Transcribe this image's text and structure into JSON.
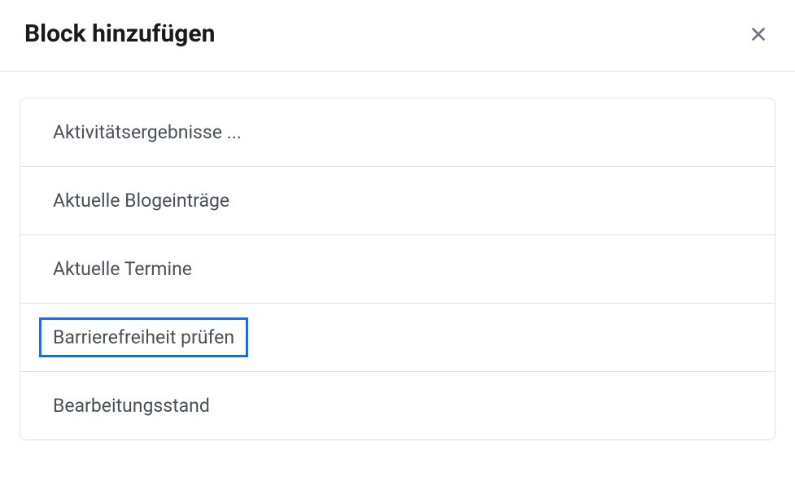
{
  "modal": {
    "title": "Block hinzufügen",
    "close_label": "close"
  },
  "blocks": [
    {
      "label": "Aktivitätsergebnisse ...",
      "selected": false
    },
    {
      "label": "Aktuelle Blogeinträge",
      "selected": false
    },
    {
      "label": "Aktuelle Termine",
      "selected": false
    },
    {
      "label": "Barrierefreiheit prüfen",
      "selected": true
    },
    {
      "label": "Bearbeitungsstand",
      "selected": false
    }
  ],
  "colors": {
    "accent": "#0d6efd",
    "text_primary": "#1a1a1a",
    "text_secondary": "#495057",
    "border": "#dee2e6"
  }
}
